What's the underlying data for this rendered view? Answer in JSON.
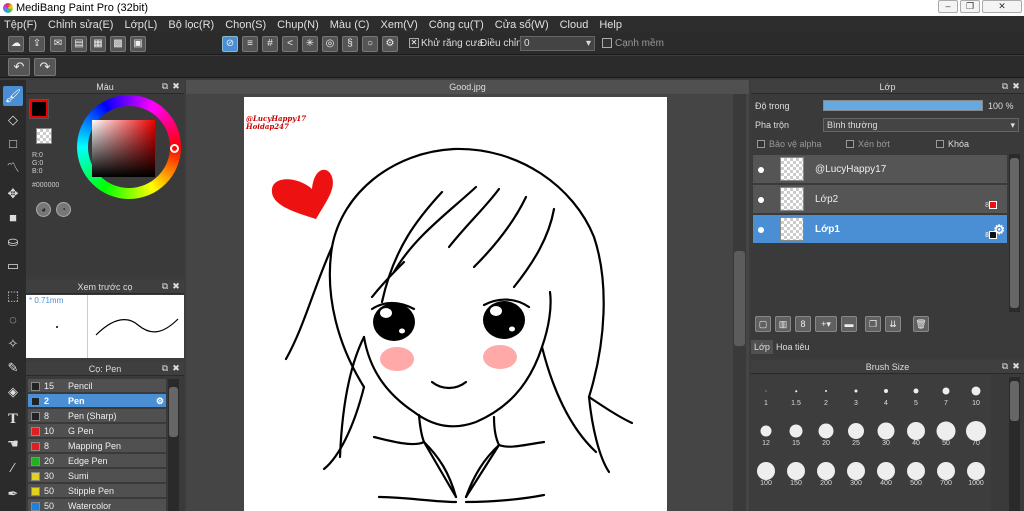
{
  "app": {
    "title": "MediBang Paint Pro (32bit)"
  },
  "menu": [
    "Tệp(F)",
    "Chỉnh sửa(E)",
    "Lớp(L)",
    "Bộ lọc(R)",
    "Chọn(S)",
    "Chụp(N)",
    "Màu (C)",
    "Xem(V)",
    "Công cụ(T)",
    "Cửa sổ(W)",
    "Cloud",
    "Help"
  ],
  "toolbar": {
    "antialias_label": "Khử răng cưa",
    "adjust_label": "Điều chỉnh",
    "adjust_value": "0",
    "edge_label": "Cạnh mềm"
  },
  "color_panel": {
    "title": "Màu",
    "r": "R:0",
    "g": "G:0",
    "b": "B:0",
    "hex": "#000000",
    "fg_color": "#000000"
  },
  "preview_panel": {
    "title": "Xem trước cọ",
    "size": "0.71mm"
  },
  "brush_panel": {
    "title": "Cọ: Pen",
    "items": [
      {
        "size": "15",
        "name": "Pencil",
        "color": "#222222"
      },
      {
        "size": "2",
        "name": "Pen",
        "color": "#222222",
        "active": true
      },
      {
        "size": "8",
        "name": "Pen (Sharp)",
        "color": "#222222"
      },
      {
        "size": "10",
        "name": "G Pen",
        "color": "#e02020"
      },
      {
        "size": "8",
        "name": "Mapping Pen",
        "color": "#e02020"
      },
      {
        "size": "20",
        "name": "Edge Pen",
        "color": "#20b020"
      },
      {
        "size": "30",
        "name": "Sumi",
        "color": "#e0d020"
      },
      {
        "size": "50",
        "name": "Stipple Pen",
        "color": "#e0d020"
      },
      {
        "size": "50",
        "name": "Watercolor",
        "color": "#2080e0"
      }
    ]
  },
  "canvas": {
    "tab": "Good.jpg",
    "watermark_line1": "@LucyHappy17",
    "watermark_line2": "Hoidap247"
  },
  "layer_panel": {
    "title": "Lớp",
    "opacity_label": "Độ trong",
    "opacity_value": "100 %",
    "opacity": 1.0,
    "blend_label": "Pha trộn",
    "blend_value": "Bình thường",
    "protect_alpha": "Bảo vệ alpha",
    "clipping": "Xén bớt",
    "lock": "Khóa",
    "layers": [
      {
        "name": "@LucyHappy17",
        "badge": ""
      },
      {
        "name": "Lớp2",
        "badge": "8"
      },
      {
        "name": "Lớp1",
        "badge": "8",
        "active": true
      }
    ],
    "tab_layer": "Lớp",
    "tab_navigator": "Hoa tiêu"
  },
  "brush_size_panel": {
    "title": "Brush Size",
    "sizes": [
      "1",
      "1.5",
      "2",
      "3",
      "4",
      "5",
      "7",
      "10",
      "12",
      "15",
      "20",
      "25",
      "30",
      "40",
      "50",
      "70",
      "100",
      "150",
      "200",
      "300",
      "400",
      "500",
      "700",
      "1000"
    ]
  }
}
